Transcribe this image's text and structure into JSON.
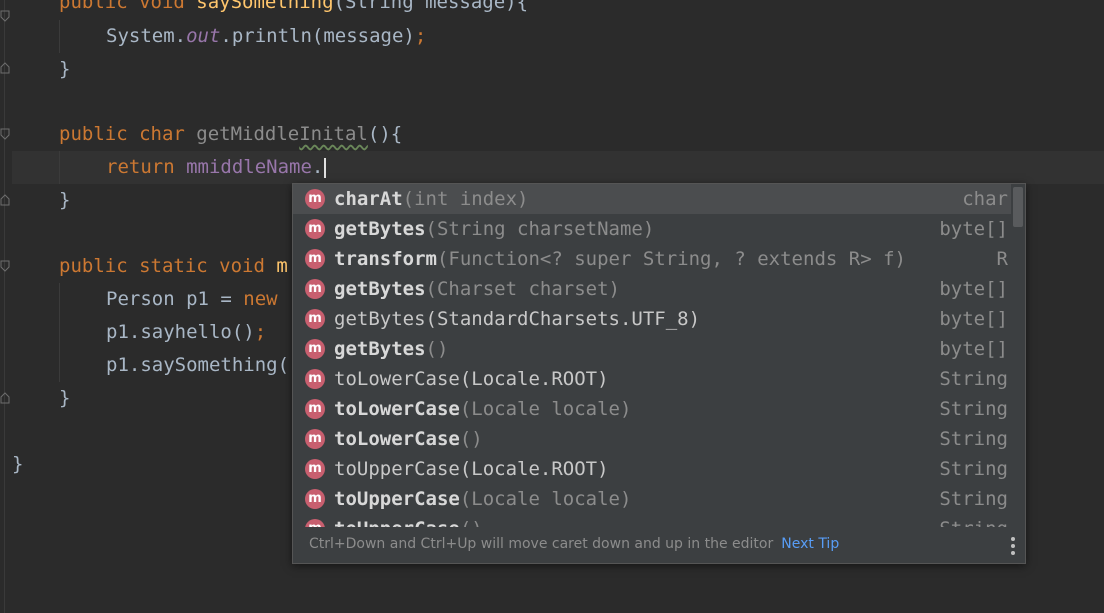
{
  "code_lines": {
    "l1": {
      "kw": "public void ",
      "fn": "saySomething",
      "rest": "(String message){"
    },
    "l2": {
      "a": "System.",
      "b": "out",
      "c": ".println(message)",
      "d": ";"
    },
    "l3": "}",
    "l5": {
      "kw": "public char ",
      "name_a": "getMiddle",
      "name_b": "Inital",
      "rest": "(){"
    },
    "l6": {
      "kw": "return ",
      "field": "mmiddleName",
      "dot": "."
    },
    "l7": "}",
    "l9": {
      "kw": "public static void ",
      "tail": "m"
    },
    "l10": {
      "a": "Person p1 = ",
      "kw": "new"
    },
    "l11": {
      "a": "p1.sayhello()",
      "b": ";"
    },
    "l12": {
      "a": "p1.saySomething("
    },
    "l13": "}",
    "l15": "}"
  },
  "completion": {
    "items": [
      {
        "name": "charAt",
        "params": "(int index)",
        "type": "char",
        "bold": true
      },
      {
        "name": "getBytes",
        "params": "(String charsetName)",
        "type": "byte[]",
        "bold": true
      },
      {
        "name": "transform",
        "params": "(Function<? super String, ? extends R> f)",
        "type": "R",
        "bold": true
      },
      {
        "name": "getBytes",
        "params": "(Charset charset)",
        "type": "byte[]",
        "bold": true
      },
      {
        "name": "getBytes(StandardCharsets.UTF_8)",
        "params": "",
        "type": "byte[]",
        "bold": false
      },
      {
        "name": "getBytes",
        "params": "()",
        "type": "byte[]",
        "bold": true
      },
      {
        "name": "toLowerCase(Locale.ROOT)",
        "params": "",
        "type": "String",
        "bold": false
      },
      {
        "name": "toLowerCase",
        "params": "(Locale locale)",
        "type": "String",
        "bold": true
      },
      {
        "name": "toLowerCase",
        "params": "()",
        "type": "String",
        "bold": true
      },
      {
        "name": "toUpperCase(Locale.ROOT)",
        "params": "",
        "type": "String",
        "bold": false
      },
      {
        "name": "toUpperCase",
        "params": "(Locale locale)",
        "type": "String",
        "bold": true
      },
      {
        "name": "toUpperCase",
        "params": "()",
        "type": "String",
        "bold": true
      }
    ],
    "badge": "m",
    "footer_text": "Ctrl+Down and Ctrl+Up will move caret down and up in the editor",
    "next_tip": "Next Tip"
  },
  "colors": {
    "keyword": "#cc7832",
    "method": "#ffc66d",
    "field": "#9876aa",
    "badge": "#c85f6f",
    "link": "#589df6"
  }
}
